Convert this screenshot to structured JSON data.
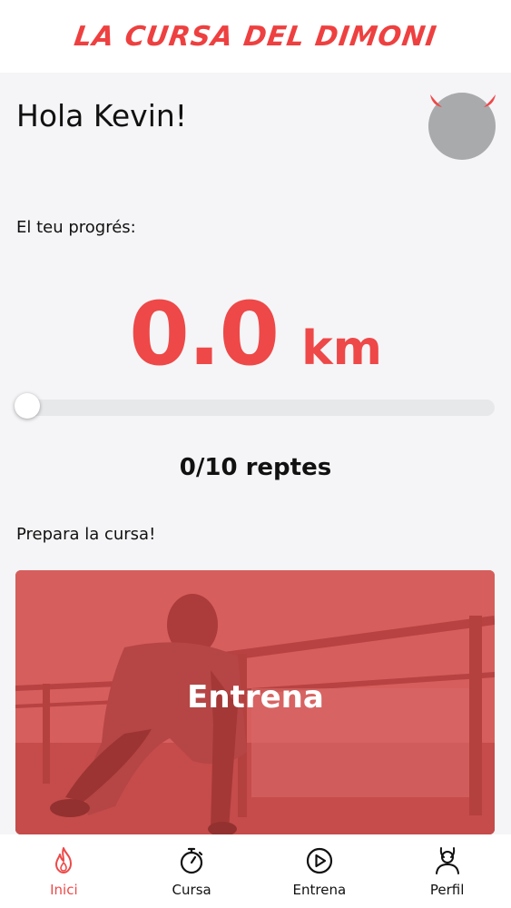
{
  "header": {
    "logo_text": "LA CURSA DEL DIMONI"
  },
  "home": {
    "greeting": "Hola Kevin!",
    "progress_label": "El teu progrés:",
    "distance_value": "0.0",
    "distance_unit": "km",
    "progress_fraction": 0.0,
    "challenges_text": "0/10 reptes",
    "prepare_label": "Prepara la cursa!",
    "card_title": "Entrena"
  },
  "tabs": [
    {
      "label": "Inici",
      "icon": "flame-icon",
      "active": true
    },
    {
      "label": "Cursa",
      "icon": "stopwatch-icon",
      "active": false
    },
    {
      "label": "Entrena",
      "icon": "play-circle-icon",
      "active": false
    },
    {
      "label": "Perfil",
      "icon": "devil-user-icon",
      "active": false
    }
  ],
  "colors": {
    "accent": "#ee4848",
    "avatar": "#a9aaac",
    "background": "#f5f5f7"
  }
}
